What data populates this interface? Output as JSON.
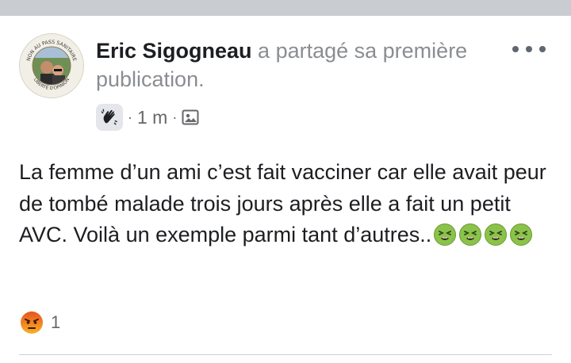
{
  "post": {
    "author_name": "Eric Sigogneau",
    "shared_text": " a partagé sa première publication.",
    "time": "1 m",
    "dot": "·",
    "body_text": "La femme d’un ami c’est fait vacciner car elle avait peur de tombé malade trois jours après elle a fait un petit AVC. Voilà un exemple parmi tant d’autres..",
    "emoji_count": 4,
    "reaction_count": "1"
  },
  "icons": {
    "wave": "waving-hand-icon",
    "audience": "photo-audience-icon",
    "more": "more-options-icon",
    "emoji": "nauseated-face-emoji",
    "reaction": "angry-reaction-icon"
  },
  "avatar": {
    "ring_text_top": "NON AU PASS SANITAIRE",
    "ring_text_bottom": "LIBERTÉ D'OPINION"
  },
  "colors": {
    "name": "#1c1e21",
    "secondary": "#8a8d91",
    "meta": "#65676b",
    "emoji": "#8bc34a",
    "angry": "#e8531c"
  }
}
